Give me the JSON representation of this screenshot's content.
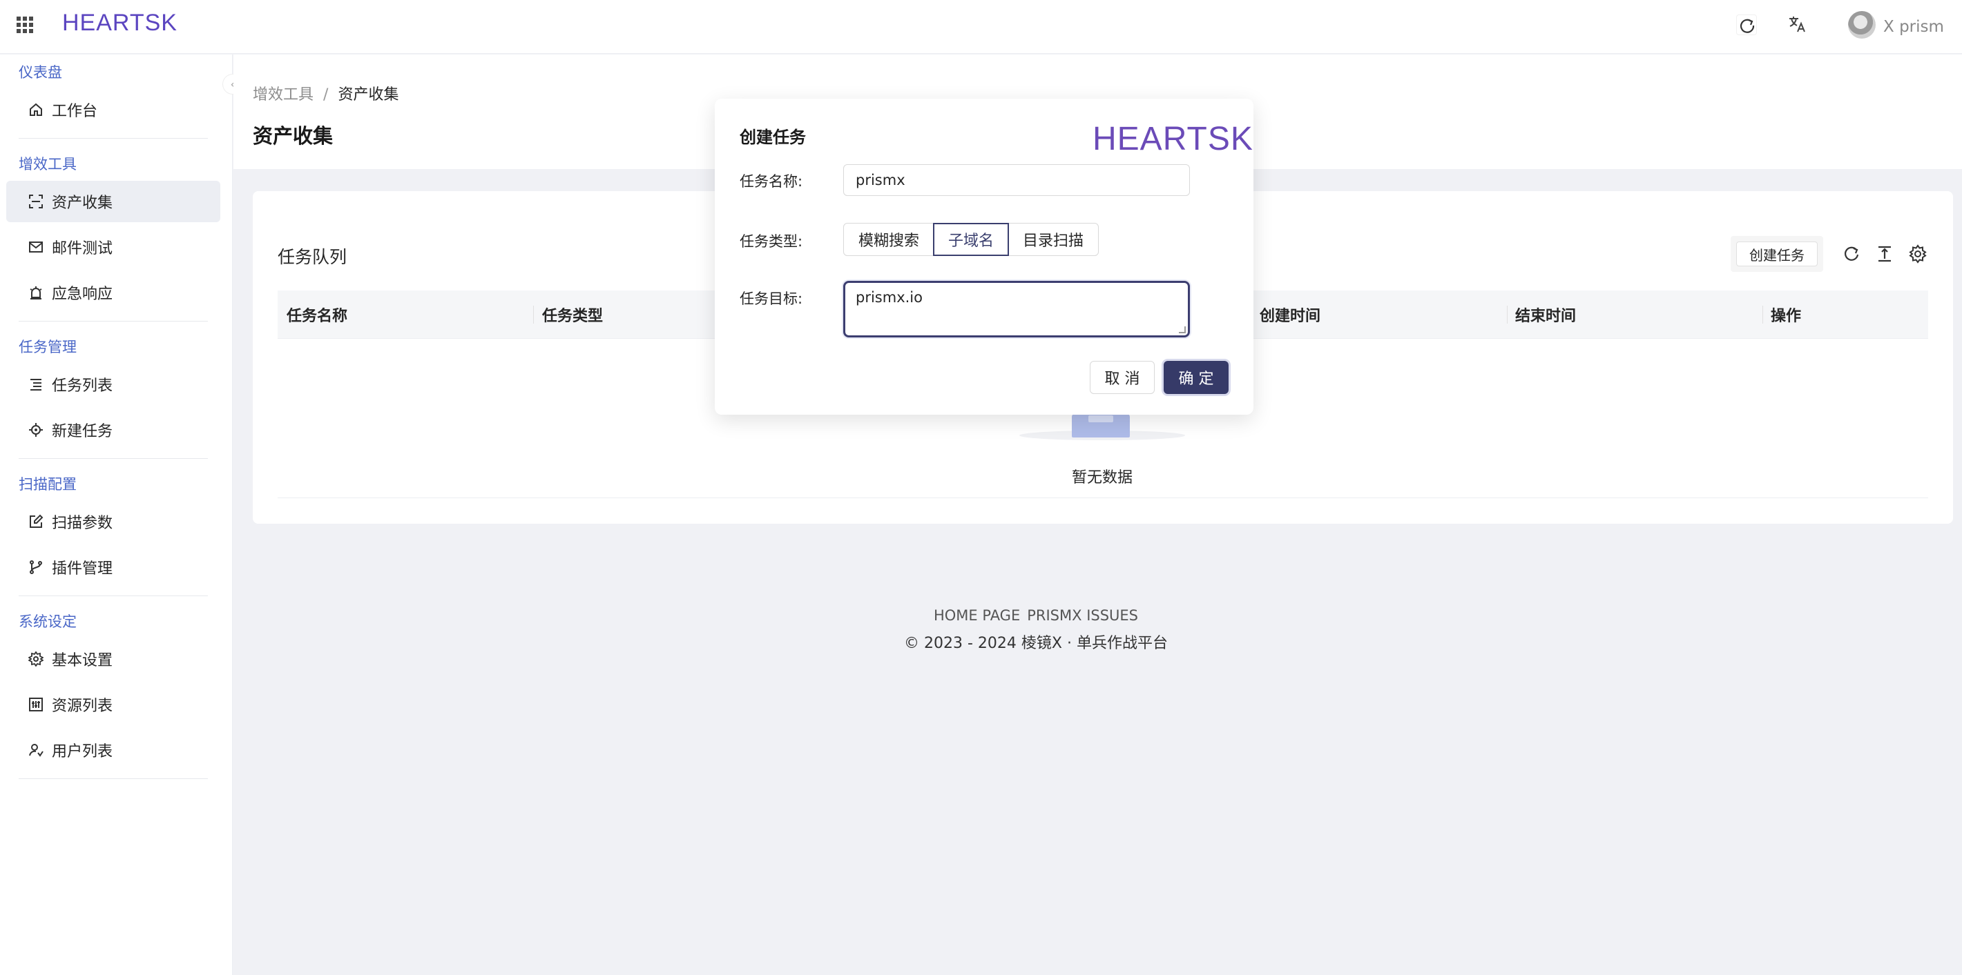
{
  "header": {
    "logo": "HEARTSK",
    "username": "X prism"
  },
  "sidebar": {
    "sections": [
      {
        "title": "仪表盘",
        "items": [
          {
            "label": "工作台",
            "icon": "home-icon"
          }
        ]
      },
      {
        "title": "增效工具",
        "items": [
          {
            "label": "资产收集",
            "icon": "scan-icon",
            "active": true
          },
          {
            "label": "邮件测试",
            "icon": "mail-icon"
          },
          {
            "label": "应急响应",
            "icon": "alarm-icon"
          }
        ]
      },
      {
        "title": "任务管理",
        "items": [
          {
            "label": "任务列表",
            "icon": "list-icon"
          },
          {
            "label": "新建任务",
            "icon": "target-icon"
          }
        ]
      },
      {
        "title": "扫描配置",
        "items": [
          {
            "label": "扫描参数",
            "icon": "edit-icon"
          },
          {
            "label": "插件管理",
            "icon": "branch-icon"
          }
        ]
      },
      {
        "title": "系统设定",
        "items": [
          {
            "label": "基本设置",
            "icon": "gear-icon"
          },
          {
            "label": "资源列表",
            "icon": "sliders-icon"
          },
          {
            "label": "用户列表",
            "icon": "user-icon"
          }
        ]
      }
    ]
  },
  "breadcrumb": {
    "parent": "增效工具",
    "current": "资产收集"
  },
  "page_title": "资产收集",
  "card": {
    "title": "任务队列",
    "create_button": "创建任务",
    "columns": [
      "任务名称",
      "任务类型",
      "创建时间",
      "结束时间",
      "操作"
    ],
    "empty_text": "暂无数据"
  },
  "footer": {
    "links": [
      "HOME PAGE",
      "PRISMX ISSUES"
    ],
    "copyright": "2023 - 2024 棱镜X · 单兵作战平台"
  },
  "modal": {
    "title": "创建任务",
    "logo": "HEARTSK",
    "name_label": "任务名称:",
    "name_value": "prismx",
    "type_label": "任务类型:",
    "type_options": [
      "模糊搜索",
      "子域名",
      "目录扫描"
    ],
    "type_selected": "子域名",
    "target_label": "任务目标:",
    "target_value": "prismx.io",
    "cancel": "取 消",
    "ok": "确 定"
  }
}
